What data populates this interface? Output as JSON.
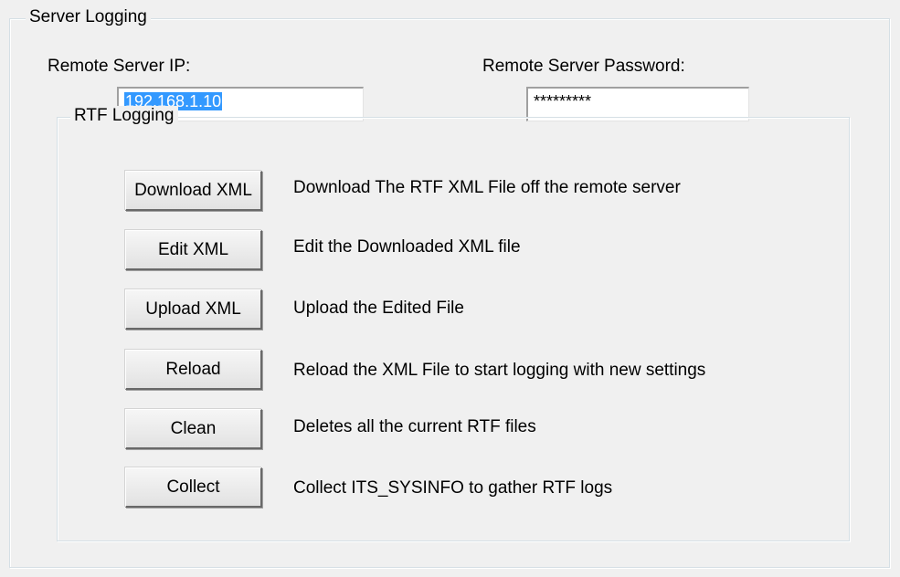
{
  "server_logging": {
    "title": "Server Logging",
    "ip_label": "Remote Server IP:",
    "ip_value": "192.168.1.10",
    "password_label": "Remote Server Password:",
    "password_value": "*********"
  },
  "rtf_logging": {
    "title": "RTF Logging",
    "actions": [
      {
        "button": "Download XML",
        "description": "Download The RTF XML File off the remote server"
      },
      {
        "button": "Edit XML",
        "description": "Edit the Downloaded XML file"
      },
      {
        "button": "Upload XML",
        "description": "Upload the Edited File"
      },
      {
        "button": "Reload",
        "description": "Reload the XML File to start logging with new settings"
      },
      {
        "button": "Clean",
        "description": "Deletes all the current RTF files"
      },
      {
        "button": "Collect",
        "description": "Collect ITS_SYSINFO to gather RTF logs"
      }
    ]
  },
  "colors": {
    "window_bg": "#f0f0f0",
    "selection": "#3399ff",
    "groupbox_border": "#d5dfe5"
  }
}
